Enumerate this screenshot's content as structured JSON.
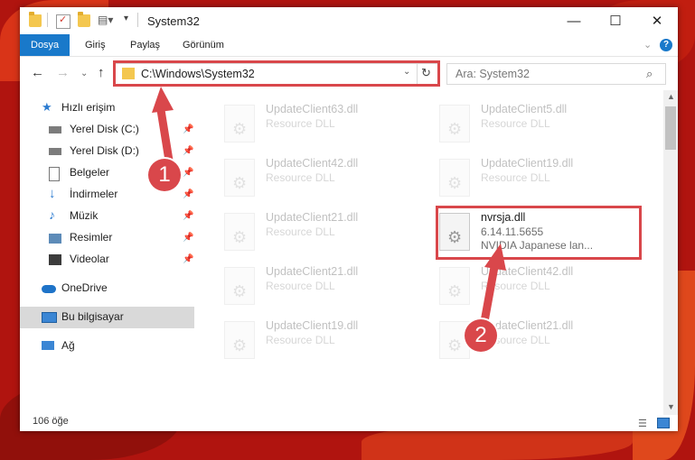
{
  "titlebar": {
    "title": "System32"
  },
  "ribbon": {
    "tabs": [
      "Dosya",
      "Giriş",
      "Paylaş",
      "Görünüm"
    ],
    "help": "?"
  },
  "navbar": {
    "address": "C:\\Windows\\System32",
    "search_placeholder": "Ara: System32"
  },
  "sidebar": {
    "items": [
      {
        "label": "Hızlı erişim"
      },
      {
        "label": "Yerel Disk (C:)"
      },
      {
        "label": "Yerel Disk (D:)"
      },
      {
        "label": "Belgeler"
      },
      {
        "label": "İndirmeler"
      },
      {
        "label": "Müzik"
      },
      {
        "label": "Resimler"
      },
      {
        "label": "Videolar"
      },
      {
        "label": "OneDrive"
      },
      {
        "label": "Bu bilgisayar"
      },
      {
        "label": "Ağ"
      }
    ]
  },
  "files": [
    {
      "name": "UpdateClient63.dll",
      "desc": "Resource DLL"
    },
    {
      "name": "UpdateClient5.dll",
      "desc": "Resource DLL"
    },
    {
      "name": "UpdateClient42.dll",
      "desc": "Resource DLL"
    },
    {
      "name": "UpdateClient19.dll",
      "desc": "Resource DLL"
    },
    {
      "name": "UpdateClient21.dll",
      "desc": "Resource DLL"
    },
    {
      "name": "nvrsja.dll",
      "version": "6.14.11.5655",
      "desc": "NVIDIA Japanese lan..."
    },
    {
      "name": "UpdateClient21.dll",
      "desc": "Resource DLL"
    },
    {
      "name": "UpdateClient42.dll",
      "desc": "Resource DLL"
    },
    {
      "name": "UpdateClient19.dll",
      "desc": "Resource DLL"
    },
    {
      "name": "UpdateClient21.dll",
      "desc": "Resource DLL"
    }
  ],
  "status": {
    "count": "106 öğe"
  },
  "annotations": {
    "badge1": "1",
    "badge2": "2"
  },
  "colors": {
    "accent": "#1979ca",
    "highlight": "#d9474b"
  }
}
